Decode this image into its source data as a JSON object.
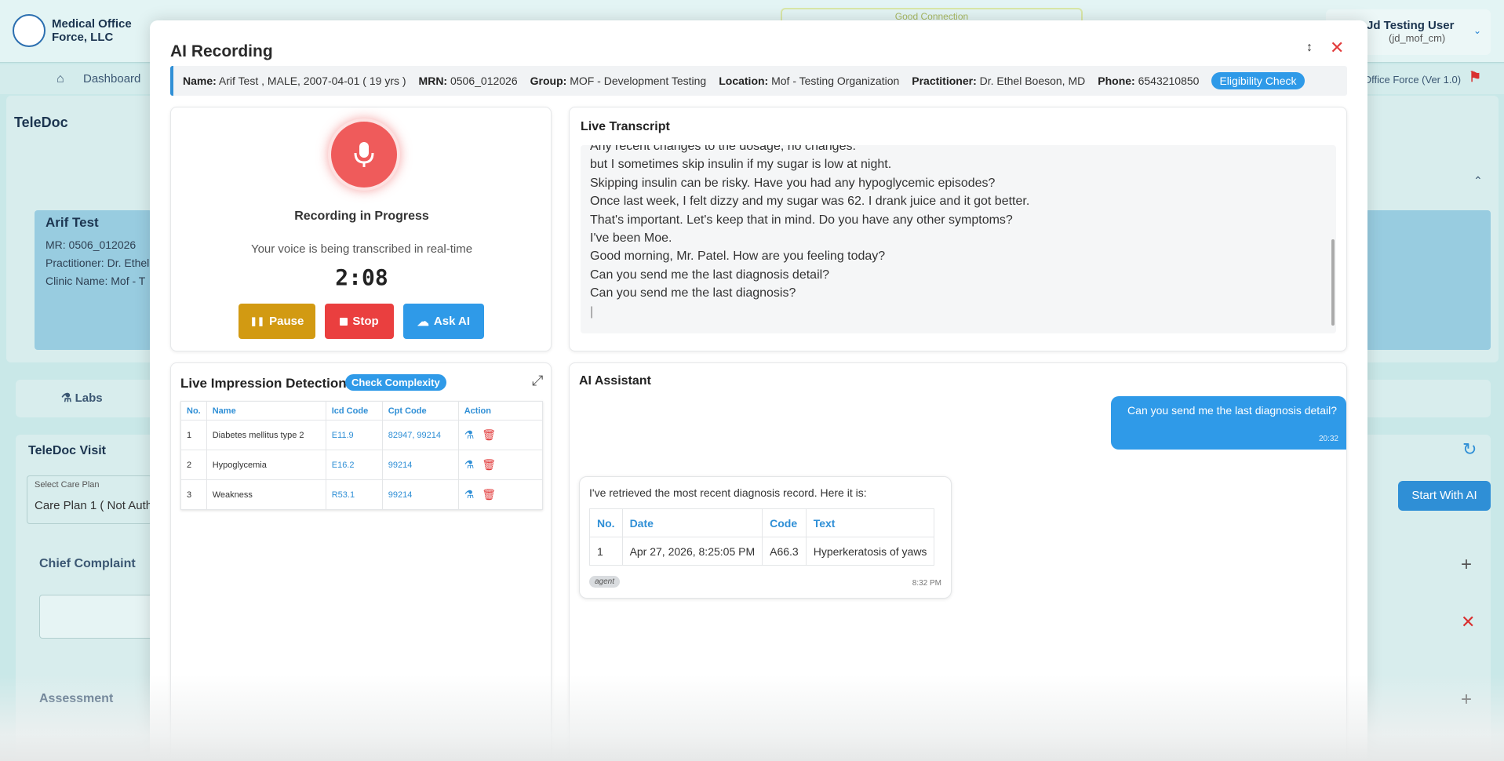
{
  "background": {
    "org_name": "Medical Office Force, LLC",
    "connection": "Good Connection",
    "user_name": "Jd Testing User",
    "user_handle": "(jd_mof_cm)",
    "nav_dashboard": "Dashboard",
    "version": "Office Force (Ver 1.0)",
    "page_title": "TeleDoc",
    "patient_card": {
      "name": "Arif Test",
      "mr": "MR: 0506_012026",
      "practitioner": "Practitioner: Dr. Ethel",
      "clinic": "Clinic Name: Mof - T"
    },
    "labs_tab": "Labs",
    "visit_title": "TeleDoc Visit",
    "care_plan_label": "Select Care Plan",
    "care_plan_value": "Care Plan 1 ( Not Auth",
    "chief_complaint": "Chief Complaint",
    "assessment": "Assessment",
    "start_with_ai": "Start With AI"
  },
  "modal": {
    "title": "AI Recording",
    "patient_bar": {
      "name_label": "Name:",
      "name_value": "Arif Test , MALE, 2007-04-01 ( 19 yrs )",
      "mrn_label": "MRN:",
      "mrn_value": "0506_012026",
      "group_label": "Group:",
      "group_value": "MOF - Development Testing",
      "location_label": "Location:",
      "location_value": "Mof - Testing Organization",
      "practitioner_label": "Practitioner:",
      "practitioner_value": "Dr. Ethel Boeson, MD",
      "phone_label": "Phone:",
      "phone_value": "6543210850",
      "eligibility_button": "Eligibility Check"
    },
    "recording": {
      "status": "Recording in Progress",
      "subtitle": "Your voice is being transcribed in real-time",
      "timer": "2:08",
      "pause_label": "Pause",
      "stop_label": "Stop",
      "ask_ai_label": "Ask AI"
    },
    "transcript": {
      "title": "Live Transcript",
      "lines": [
        "Any recent changes to the dosage, no changes.",
        "but I sometimes skip insulin if my sugar is low at night.",
        "Skipping insulin can be risky. Have you had any hypoglycemic episodes?",
        "Once last week, I felt dizzy and my sugar was 62. I drank juice and it got better.",
        "That's important. Let's keep that in mind. Do you have any other symptoms?",
        "I've been Moe.",
        "Good morning, Mr. Patel. How are you feeling today?",
        "Can you send me the last diagnosis detail?",
        "Can you send me the last diagnosis?",
        "|"
      ]
    },
    "impressions": {
      "title": "Live Impression Detection",
      "complexity_button": "Check Complexity",
      "columns": [
        "No.",
        "Name",
        "Icd Code",
        "Cpt Code",
        "Action"
      ],
      "rows": [
        {
          "no": "1",
          "name": "Diabetes mellitus type 2",
          "icd": "E11.9",
          "cpt": "82947, 99214"
        },
        {
          "no": "2",
          "name": "Hypoglycemia",
          "icd": "E16.2",
          "cpt": "99214"
        },
        {
          "no": "3",
          "name": "Weakness",
          "icd": "R53.1",
          "cpt": "99214"
        }
      ]
    },
    "assistant": {
      "title": "AI Assistant",
      "user_message": "Can you send me the last diagnosis detail?",
      "user_time": "20:32",
      "agent_message": "I've retrieved the most recent diagnosis record. Here it is:",
      "agent_columns": [
        "No.",
        "Date",
        "Code",
        "Text"
      ],
      "agent_rows": [
        {
          "no": "1",
          "date": "Apr 27, 2026, 8:25:05 PM",
          "code": "A66.3",
          "text": "Hyperkeratosis of yaws"
        }
      ],
      "agent_tag": "agent",
      "agent_time": "8:32 PM"
    }
  },
  "colors": {
    "accent": "#2f9ae8",
    "pause": "#d29a12",
    "stop": "#ea3f3f",
    "mic": "#ef5b5b"
  },
  "icons": {
    "mic": "microphone-icon",
    "pause": "pause-icon",
    "stop": "stop-icon",
    "ask_ai": "cloud-icon",
    "close": "close-icon",
    "minimize": "collapse-icon",
    "expand": "expand-icon",
    "flask": "flask-icon",
    "trash": "trash-icon"
  }
}
